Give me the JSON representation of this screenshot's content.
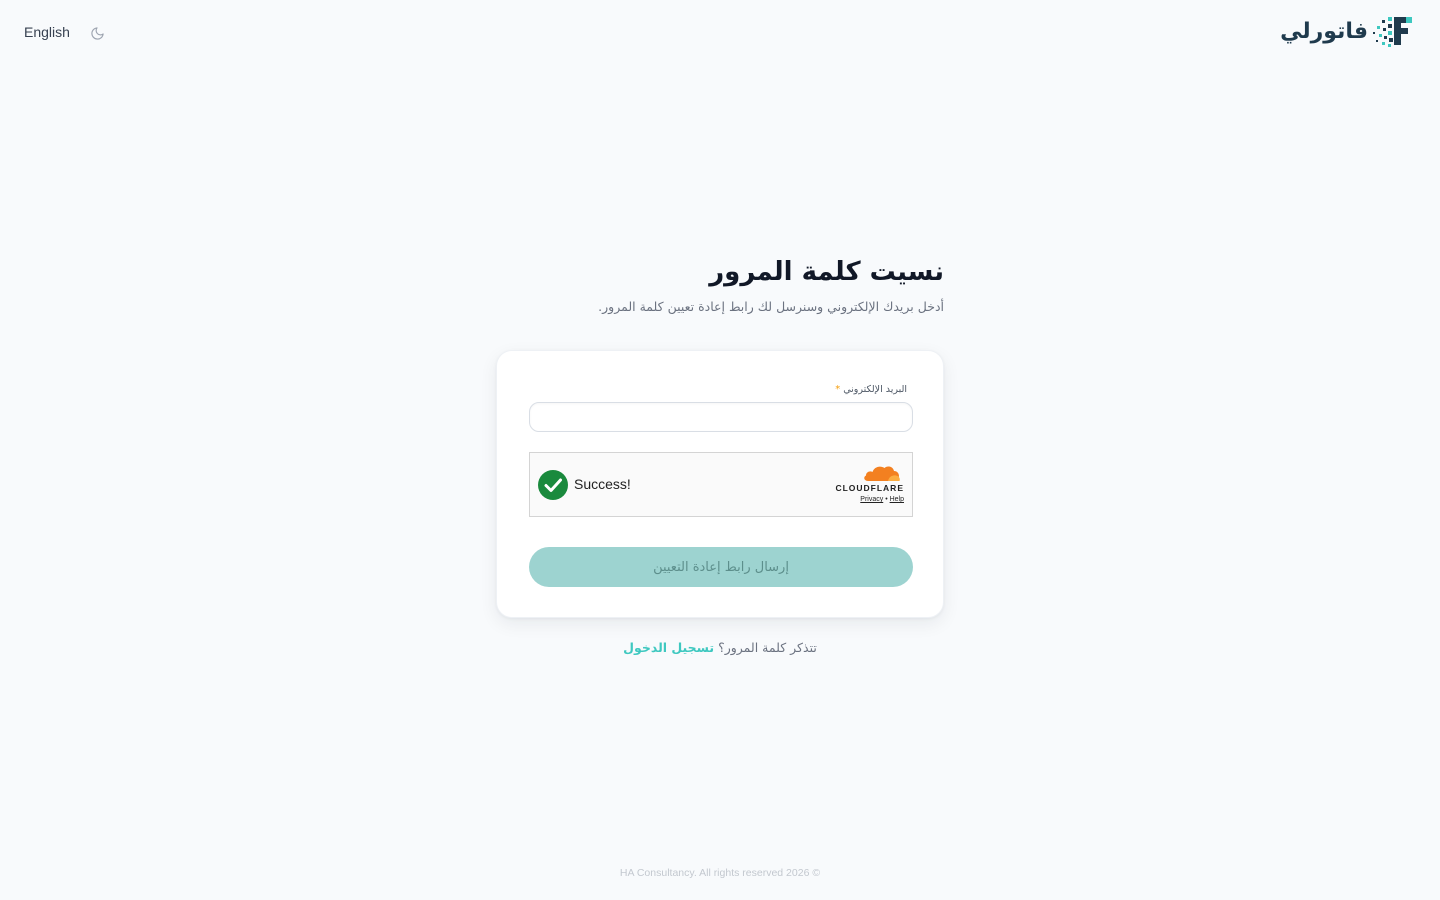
{
  "brand": {
    "name": "فاتورلي",
    "logo_icon": "pixel-f-logo",
    "colors": {
      "dark": "#1f3a4d",
      "accent": "#3ec8c0"
    }
  },
  "topbar": {
    "language_label": "English",
    "theme_icon": "moon-icon"
  },
  "page": {
    "title": "نسيت كلمة المرور",
    "subtitle": "أدخل بريدك الإلكتروني وسنرسل لك رابط إعادة تعيين كلمة المرور."
  },
  "form": {
    "email_label": "البريد الإلكتروني",
    "required_mark": "*",
    "email_value": "",
    "email_placeholder": "",
    "submit_label": "إرسال رابط إعادة التعيين",
    "submit_color": "#9dd3d0"
  },
  "captcha": {
    "status_text": "Success!",
    "status_icon": "check-circle-icon",
    "status_color": "#1a8a3d",
    "provider_word": "CLOUDFLARE",
    "privacy_link": "Privacy",
    "separator": "•",
    "help_link": "Help"
  },
  "remember": {
    "question": "تتذكر كلمة المرور؟",
    "login_link": "تسجيل الدخول"
  },
  "footer": {
    "text": "HA Consultancy. All rights reserved 2026 ©"
  }
}
